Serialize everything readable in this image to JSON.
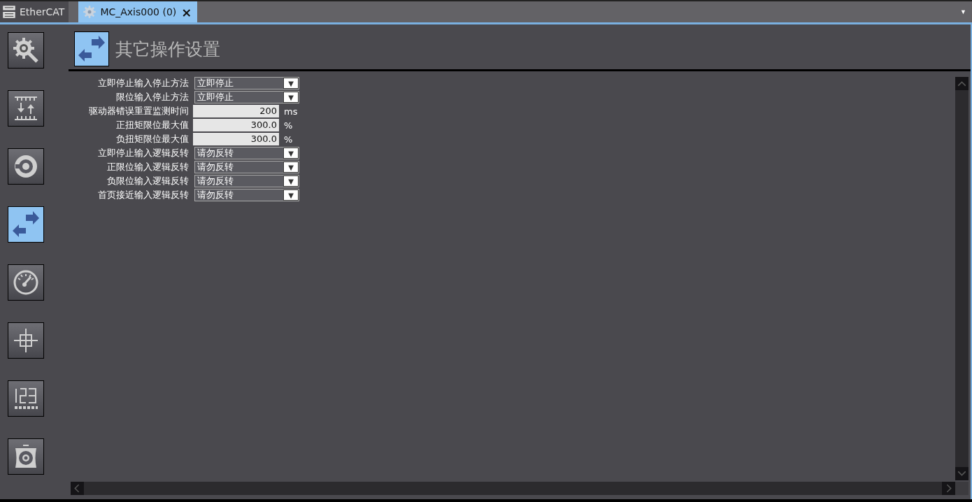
{
  "tabs": [
    {
      "label": "EtherCAT",
      "selected": false
    },
    {
      "label": "MC_Axis000 (0)",
      "selected": true,
      "close": "×"
    }
  ],
  "tab_menu": "▼",
  "sidebar": {
    "items": [
      {
        "selected": false
      },
      {
        "selected": false
      },
      {
        "selected": false
      },
      {
        "selected": true
      },
      {
        "selected": false
      },
      {
        "selected": false
      },
      {
        "selected": false
      },
      {
        "selected": false
      }
    ]
  },
  "page": {
    "title": "其它操作设置"
  },
  "settings": [
    {
      "kind": "dropdown",
      "label": "立即停止输入停止方法",
      "value": "立即停止",
      "arrow": "▼"
    },
    {
      "kind": "dropdown",
      "label": "限位输入停止方法",
      "value": "立即停止",
      "arrow": "▼"
    },
    {
      "kind": "number",
      "label": "驱动器错误重置监测时间",
      "value": "200",
      "unit": "ms"
    },
    {
      "kind": "number",
      "label": "正扭矩限位最大值",
      "value": "300.0",
      "unit": "%"
    },
    {
      "kind": "number",
      "label": "负扭矩限位最大值",
      "value": "300.0",
      "unit": "%"
    },
    {
      "kind": "dropdown",
      "label": "立即停止输入逻辑反转",
      "value": "请勿反转",
      "arrow": "▼"
    },
    {
      "kind": "dropdown",
      "label": "正限位输入逻辑反转",
      "value": "请勿反转",
      "arrow": "▼"
    },
    {
      "kind": "dropdown",
      "label": "负限位输入逻辑反转",
      "value": "请勿反转",
      "arrow": "▼"
    },
    {
      "kind": "dropdown",
      "label": "首页接近输入逻辑反转",
      "value": "请勿反转",
      "arrow": "▼"
    }
  ]
}
